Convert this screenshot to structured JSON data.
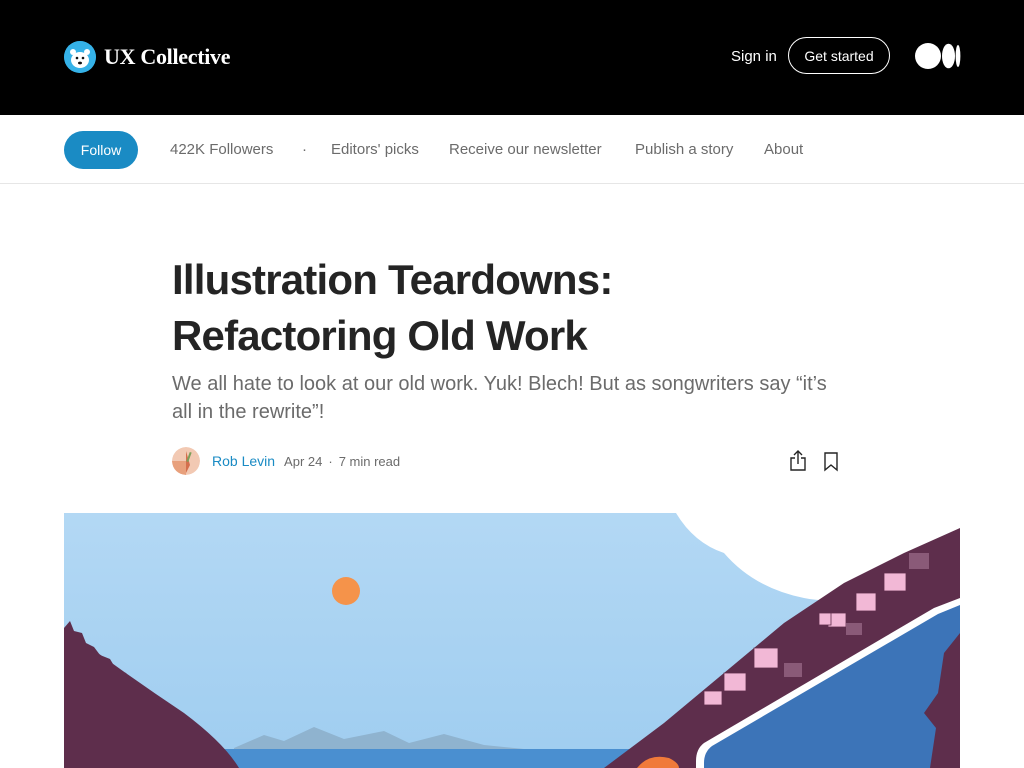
{
  "header": {
    "brand_name": "UX Collective",
    "sign_in": "Sign in",
    "get_started": "Get started"
  },
  "subnav": {
    "follow": "Follow",
    "followers": "422K Followers",
    "separator": "·",
    "links": [
      "Editors' picks",
      "Receive our newsletter",
      "Publish a story",
      "About"
    ]
  },
  "article": {
    "title_line1": "Illustration Teardowns:",
    "title_line2": "Refactoring Old Work",
    "subtitle": "We all hate to look at our old work. Yuk! Blech! But as songwriters say “it’s all in the rewrite”!",
    "author": "Rob Levin",
    "date": "Apr 24",
    "meta_separator": "·",
    "read_time": "7 min read"
  },
  "colors": {
    "accent": "#1a8bc4",
    "header_bg": "#000000",
    "sky": "#a9d3f2",
    "hill": "#5e2e4c",
    "sun": "#f5934a"
  }
}
